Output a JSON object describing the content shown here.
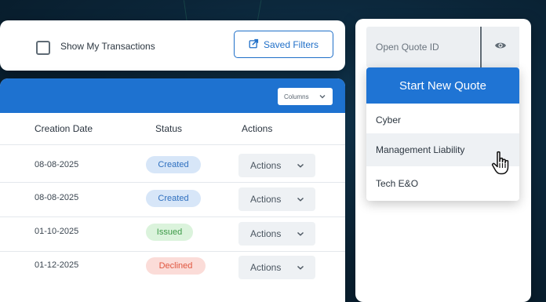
{
  "filters": {
    "show_my_transactions_label": "Show My Transactions",
    "saved_filters_label": "Saved Filters"
  },
  "table": {
    "columns_button_label": "Columns",
    "headers": {
      "creation_date": "Creation Date",
      "status": "Status",
      "actions": "Actions"
    },
    "rows": [
      {
        "date": "08-08-2025",
        "status": "Created",
        "action": "Actions"
      },
      {
        "date": "08-08-2025",
        "status": "Created",
        "action": "Actions"
      },
      {
        "date": "01-10-2025",
        "status": "Issued",
        "action": "Actions"
      },
      {
        "date": "01-12-2025",
        "status": "Declined",
        "action": "Actions"
      }
    ]
  },
  "quote": {
    "open_quote_placeholder": "Open Quote ID",
    "start_new_quote_label": "Start New Quote",
    "menu_items": [
      "Cyber",
      "Management Liability",
      "Tech E&O"
    ]
  },
  "colors": {
    "primary": "#1f74d4",
    "status_created": "#2e6fbf",
    "status_issued": "#3c9a47",
    "status_declined": "#e0563f"
  },
  "icons": {
    "saved_filters": "share-external-icon",
    "columns": "chevron-down-icon",
    "actions": "chevron-down-icon",
    "quote_lookup": "eye-icon",
    "cursor": "hand-pointer-icon"
  }
}
